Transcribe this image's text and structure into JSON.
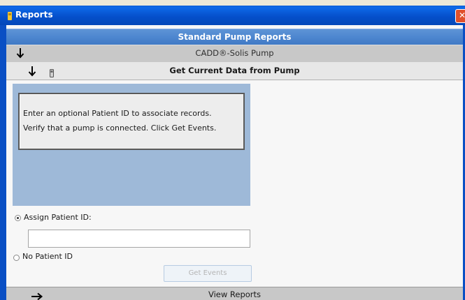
{
  "window": {
    "title": "Reports",
    "close_symbol": "✕",
    "icons": {
      "title": "app-icon",
      "close": "close-icon"
    }
  },
  "header": {
    "title": "Standard Pump Reports"
  },
  "pump_section": {
    "label": "CADD®-Solis Pump",
    "icon": "chevron-down-icon"
  },
  "data_section": {
    "label": "Get Current Data from Pump",
    "icons": [
      "chevron-down-icon",
      "pump-icon"
    ]
  },
  "instructions": {
    "line1": "Enter an optional Patient ID to associate records.",
    "line2": "Verify that a pump is connected. Click Get Events."
  },
  "patient_options": {
    "assign": {
      "label": "Assign Patient ID:",
      "selected": true
    },
    "none": {
      "label": "No Patient ID",
      "selected": false
    },
    "patient_id_value": ""
  },
  "actions": {
    "get_events_label": "Get Events",
    "get_events_enabled": false
  },
  "footer": {
    "label": "View Reports",
    "icon": "arrow-right-icon"
  },
  "colors": {
    "title_bar": "#0550cc",
    "header_blue": "#4d86cf",
    "panel_blue": "#9eb9d8",
    "row_gray": "#c8c8c8",
    "close_red": "#e0502c"
  }
}
